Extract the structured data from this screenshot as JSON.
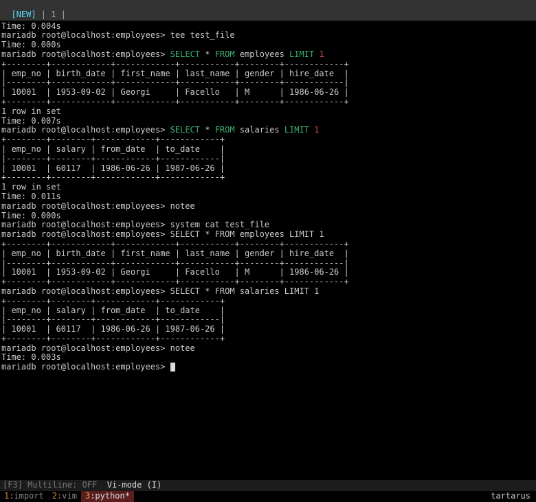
{
  "topbar": {
    "new_label": "[NEW]",
    "rest": " | 1 |"
  },
  "lines": [
    {
      "t": [
        {
          "s": "",
          "v": "Time: 0.004s"
        }
      ]
    },
    {
      "t": [
        {
          "s": "",
          "v": "mariadb root@localhost:employees> tee test_file"
        }
      ]
    },
    {
      "t": [
        {
          "s": "",
          "v": "Time: 0.000s"
        }
      ]
    },
    {
      "t": [
        {
          "s": "",
          "v": "mariadb root@localhost:employees> "
        },
        {
          "s": "green",
          "v": "SELECT"
        },
        {
          "s": "",
          "v": " * "
        },
        {
          "s": "green",
          "v": "FROM"
        },
        {
          "s": "",
          "v": " employees "
        },
        {
          "s": "green",
          "v": "LIMIT"
        },
        {
          "s": "",
          "v": " "
        },
        {
          "s": "red",
          "v": "1"
        }
      ]
    },
    {
      "t": [
        {
          "s": "",
          "v": "+--------+------------+------------+-----------+--------+------------+"
        }
      ]
    },
    {
      "t": [
        {
          "s": "",
          "v": "| emp_no | birth_date | first_name | last_name | gender | hire_date  |"
        }
      ]
    },
    {
      "t": [
        {
          "s": "",
          "v": "|--------+------------+------------+-----------+--------+------------|"
        }
      ]
    },
    {
      "t": [
        {
          "s": "",
          "v": "| 10001  | 1953-09-02 | Georgi     | Facello   | M      | 1986-06-26 |"
        }
      ]
    },
    {
      "t": [
        {
          "s": "",
          "v": "+--------+------------+------------+-----------+--------+------------+"
        }
      ]
    },
    {
      "t": [
        {
          "s": "",
          "v": "1 row in set"
        }
      ]
    },
    {
      "t": [
        {
          "s": "",
          "v": "Time: 0.007s"
        }
      ]
    },
    {
      "t": [
        {
          "s": "",
          "v": "mariadb root@localhost:employees> "
        },
        {
          "s": "green",
          "v": "SELECT"
        },
        {
          "s": "",
          "v": " * "
        },
        {
          "s": "green",
          "v": "FROM"
        },
        {
          "s": "",
          "v": " salaries "
        },
        {
          "s": "green",
          "v": "LIMIT"
        },
        {
          "s": "",
          "v": " "
        },
        {
          "s": "red",
          "v": "1"
        }
      ]
    },
    {
      "t": [
        {
          "s": "",
          "v": "+--------+--------+------------+------------+"
        }
      ]
    },
    {
      "t": [
        {
          "s": "",
          "v": "| emp_no | salary | from_date  | to_date    |"
        }
      ]
    },
    {
      "t": [
        {
          "s": "",
          "v": "|--------+--------+------------+------------|"
        }
      ]
    },
    {
      "t": [
        {
          "s": "",
          "v": "| 10001  | 60117  | 1986-06-26 | 1987-06-26 |"
        }
      ]
    },
    {
      "t": [
        {
          "s": "",
          "v": "+--------+--------+------------+------------+"
        }
      ]
    },
    {
      "t": [
        {
          "s": "",
          "v": "1 row in set"
        }
      ]
    },
    {
      "t": [
        {
          "s": "",
          "v": "Time: 0.011s"
        }
      ]
    },
    {
      "t": [
        {
          "s": "",
          "v": "mariadb root@localhost:employees> notee"
        }
      ]
    },
    {
      "t": [
        {
          "s": "",
          "v": "Time: 0.000s"
        }
      ]
    },
    {
      "t": [
        {
          "s": "",
          "v": "mariadb root@localhost:employees> system cat test_file"
        }
      ]
    },
    {
      "t": [
        {
          "s": "",
          "v": "mariadb root@localhost:employees> SELECT * FROM employees LIMIT 1"
        }
      ]
    },
    {
      "t": [
        {
          "s": "",
          "v": "+--------+------------+------------+-----------+--------+------------+"
        }
      ]
    },
    {
      "t": [
        {
          "s": "",
          "v": "| emp_no | birth_date | first_name | last_name | gender | hire_date  |"
        }
      ]
    },
    {
      "t": [
        {
          "s": "",
          "v": "|--------+------------+------------+-----------+--------+------------|"
        }
      ]
    },
    {
      "t": [
        {
          "s": "",
          "v": "| 10001  | 1953-09-02 | Georgi     | Facello   | M      | 1986-06-26 |"
        }
      ]
    },
    {
      "t": [
        {
          "s": "",
          "v": "+--------+------------+------------+-----------+--------+------------+"
        }
      ]
    },
    {
      "t": [
        {
          "s": "",
          "v": "mariadb root@localhost:employees> SELECT * FROM salaries LIMIT 1"
        }
      ]
    },
    {
      "t": [
        {
          "s": "",
          "v": "+--------+--------+------------+------------+"
        }
      ]
    },
    {
      "t": [
        {
          "s": "",
          "v": "| emp_no | salary | from_date  | to_date    |"
        }
      ]
    },
    {
      "t": [
        {
          "s": "",
          "v": "|--------+--------+------------+------------|"
        }
      ]
    },
    {
      "t": [
        {
          "s": "",
          "v": "| 10001  | 60117  | 1986-06-26 | 1987-06-26 |"
        }
      ]
    },
    {
      "t": [
        {
          "s": "",
          "v": "+--------+--------+------------+------------+"
        }
      ]
    },
    {
      "t": [
        {
          "s": "",
          "v": "mariadb root@localhost:employees> notee"
        }
      ]
    },
    {
      "t": [
        {
          "s": "",
          "v": ""
        }
      ]
    },
    {
      "t": [
        {
          "s": "",
          "v": "Time: 0.003s"
        }
      ]
    },
    {
      "t": [
        {
          "s": "",
          "v": "mariadb root@localhost:employees> "
        }
      ],
      "cursor": true
    }
  ],
  "status": {
    "left": "[F3] Multiline: OFF  ",
    "vi": "Vi-mode (I)"
  },
  "tmux": {
    "windows": [
      {
        "num": "1",
        "name": ":import",
        "active": false
      },
      {
        "num": "2",
        "name": ":vim",
        "active": false
      },
      {
        "num": "3",
        "name": ":python*",
        "active": true
      }
    ],
    "host": "tartarus"
  }
}
